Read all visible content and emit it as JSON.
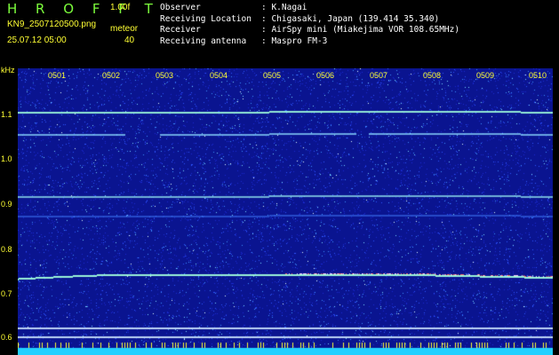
{
  "header": {
    "logo": "H R O F F T",
    "version": "1.00f",
    "filename": "KN9_2507120500.png",
    "meteor_label": "meteor",
    "datetime": "25.07.12 05:00",
    "count": "40"
  },
  "info": [
    {
      "label": "Observer",
      "value": "K.Nagai"
    },
    {
      "label": "Receiving Location",
      "value": "Chigasaki, Japan (139.414 35.340)"
    },
    {
      "label": "Receiver",
      "value": "AirSpy mini (Miakejima VOR 108.65MHz)"
    },
    {
      "label": "Receiving antenna",
      "value": "Maspro FM-3"
    }
  ],
  "axis": {
    "unit": "kHz",
    "yticks": [
      "1.1",
      "1.0",
      "0.9",
      "0.8",
      "0.7",
      "0.6"
    ],
    "xticks": [
      "0501",
      "0502",
      "0503",
      "0504",
      "0505",
      "0506",
      "0507",
      "0508",
      "0509",
      "0510"
    ]
  },
  "colors": {
    "background": "#0a1490",
    "label": "#ffff33",
    "logo": "#7cfc3c",
    "trace": "#8af0d8"
  }
}
